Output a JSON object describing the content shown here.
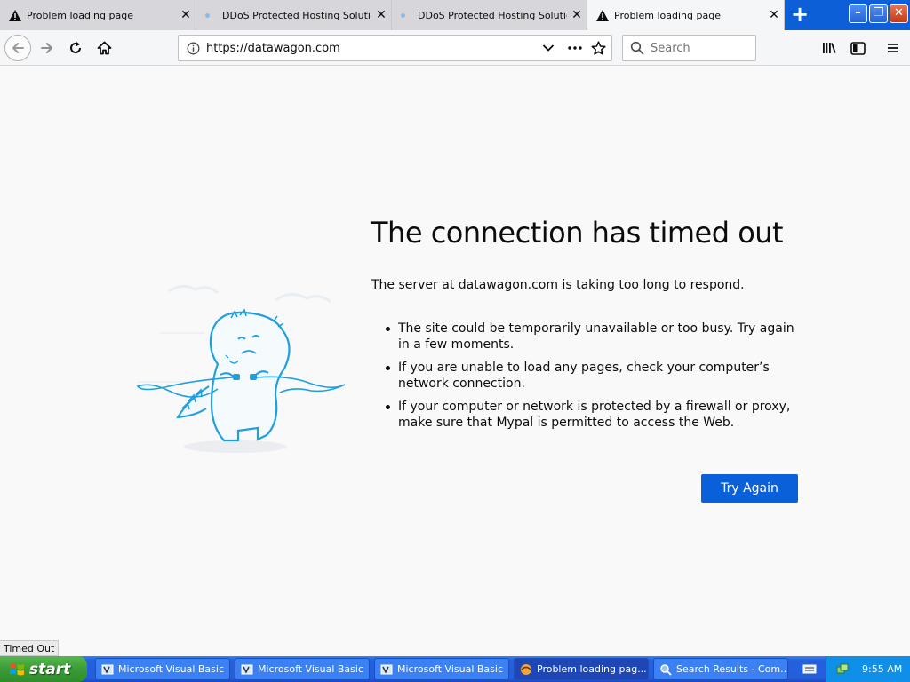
{
  "tabs": [
    {
      "title": "Problem loading page",
      "icon": "warning-icon",
      "active": false
    },
    {
      "title": "DDoS Protected Hosting Solutions",
      "icon": "favicon-dot",
      "active": false
    },
    {
      "title": "DDoS Protected Hosting Solutions",
      "icon": "favicon-dot",
      "active": false
    },
    {
      "title": "Problem loading page",
      "icon": "warning-icon",
      "active": true
    }
  ],
  "tab_close_glyph": "✕",
  "new_tab_glyph": "+",
  "window_buttons": {
    "minimize": "–",
    "maximize": "❐",
    "close": "✕"
  },
  "nav": {
    "url": "https://datawagon.com",
    "search_placeholder": "Search"
  },
  "error": {
    "title": "The connection has timed out",
    "description": "The server at datawagon.com is taking too long to respond.",
    "reasons": [
      "The site could be temporarily unavailable or too busy. Try again in a few moments.",
      "If you are unable to load any pages, check your computer’s network connection.",
      "If your computer or network is protected by a firewall or proxy, make sure that Mypal is permitted to access the Web."
    ],
    "button_label": "Try Again"
  },
  "status_text": "Timed Out",
  "taskbar": {
    "start_label": "start",
    "tasks": [
      {
        "label": "Microsoft Visual Basic",
        "active": false
      },
      {
        "label": "Microsoft Visual Basic",
        "active": false
      },
      {
        "label": "Microsoft Visual Basic",
        "active": false
      },
      {
        "label": "Problem loading pag...",
        "active": true
      },
      {
        "label": "Search Results - Com...",
        "active": false
      }
    ],
    "clock": "9:55 AM"
  },
  "colors": {
    "accent": "#0a60d9",
    "taskbar": "#245edb",
    "start_button": "#3c9b36",
    "illustration": "#1ea0e0"
  }
}
